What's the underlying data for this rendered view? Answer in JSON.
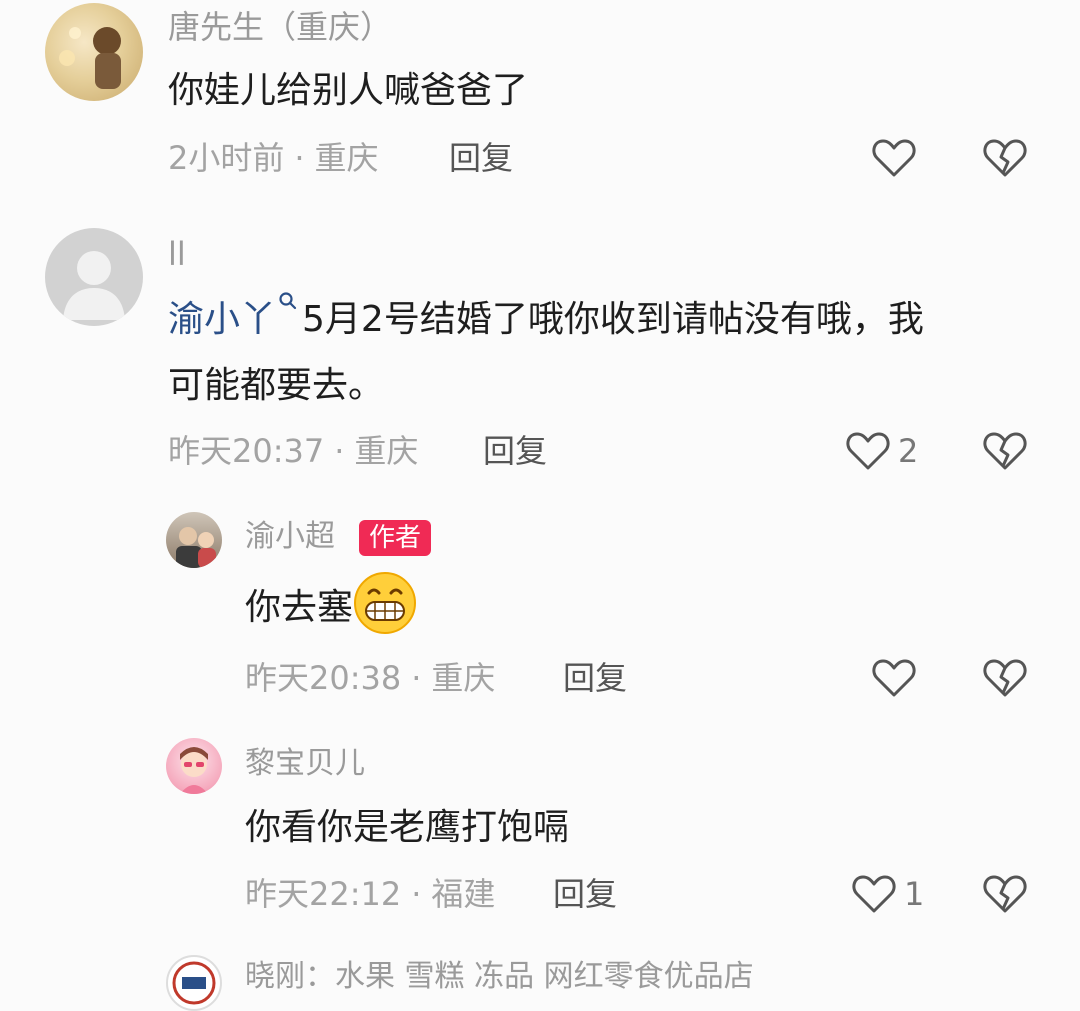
{
  "comments": [
    {
      "username": "唐先生（重庆）",
      "content": "你娃儿给别人喊爸爸了",
      "time": "2小时前",
      "location": "重庆",
      "reply_label": "回复",
      "like_count": ""
    },
    {
      "username": "ll",
      "mention": "渝小丫",
      "content": "5月2号结婚了哦你收到请帖没有哦，我",
      "content_line2": "可能都要去。",
      "time": "昨天20:37",
      "location": "重庆",
      "reply_label": "回复",
      "like_count": "2"
    },
    {
      "username": "渝小超",
      "badge": "作者",
      "content": "你去塞",
      "emoji": "grinning-face-emoji",
      "time": "昨天20:38",
      "location": "重庆",
      "reply_label": "回复",
      "like_count": ""
    },
    {
      "username": "黎宝贝儿",
      "content": "你看你是老鹰打饱嗝",
      "time": "昨天22:12",
      "location": "福建",
      "reply_label": "回复",
      "like_count": "1"
    },
    {
      "username": "晓刚：水果 雪糕 冻品 网红零食优品店"
    }
  ],
  "separator": "·",
  "colors": {
    "mention": "#2a4f88",
    "badge": "#f02a55",
    "meta": "#a3a3a3"
  }
}
